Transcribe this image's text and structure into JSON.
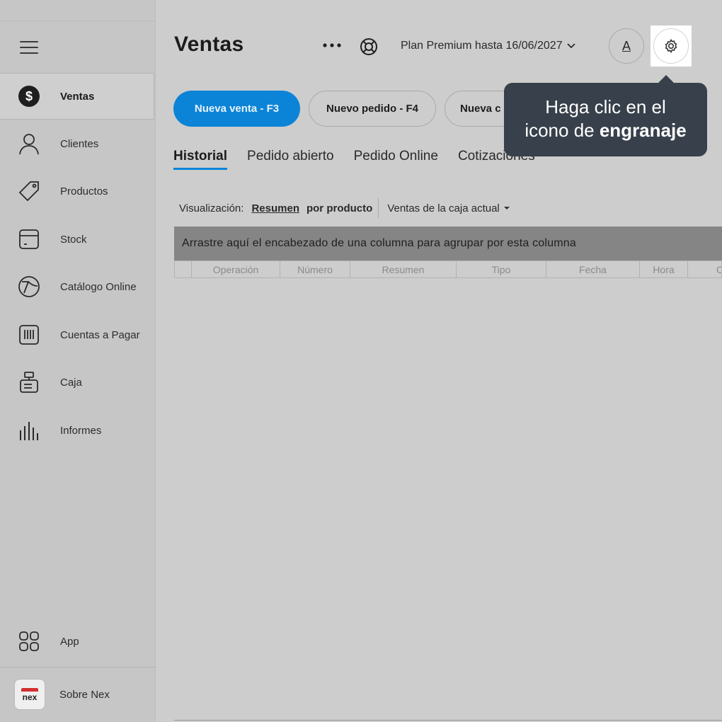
{
  "sidebar": {
    "items": [
      {
        "label": "Ventas",
        "icon": "dollar-circle-icon"
      },
      {
        "label": "Clientes",
        "icon": "person-icon"
      },
      {
        "label": "Productos",
        "icon": "tag-icon"
      },
      {
        "label": "Stock",
        "icon": "box-icon"
      },
      {
        "label": "Catálogo Online",
        "icon": "catalog-icon"
      },
      {
        "label": "Cuentas a Pagar",
        "icon": "barcode-icon"
      },
      {
        "label": "Caja",
        "icon": "cash-register-icon"
      },
      {
        "label": "Informes",
        "icon": "bar-chart-icon"
      }
    ],
    "app_label": "App",
    "about_label": "Sobre Nex",
    "logo_text": "nex"
  },
  "header": {
    "title": "Ventas",
    "plan": "Plan Premium hasta 16/06/2027",
    "avatar_letter": "A"
  },
  "tooltip": {
    "line1": "Haga clic en el",
    "line2_prefix": "icono de ",
    "line2_bold": "engranaje"
  },
  "actions": {
    "new_sale": "Nueva venta - F3",
    "new_order": "Nuevo pedido - F4",
    "third": "Nueva c"
  },
  "tabs": [
    "Historial",
    "Pedido abierto",
    "Pedido Online",
    "Cotizaciones"
  ],
  "viewbar": {
    "label": "Visualización:",
    "option_summary": "Resumen",
    "option_product": "por producto",
    "filter": "Ventas de la caja actual"
  },
  "grid": {
    "group_hint": "Arrastre aquí el encabezado de una columna para agrupar por esta columna",
    "columns": [
      "Operación",
      "Número",
      "Resumen",
      "Tipo",
      "Fecha",
      "Hora",
      "C"
    ]
  },
  "colors": {
    "accent": "#0b84d8",
    "tooltip_bg": "#37404b",
    "logo_red": "#d32f2f"
  }
}
